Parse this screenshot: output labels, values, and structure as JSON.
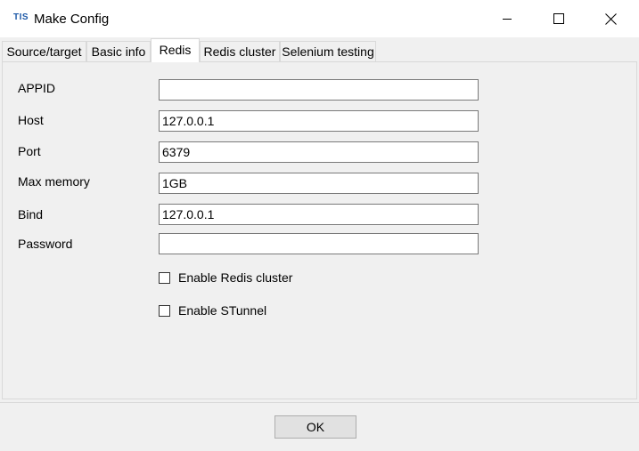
{
  "window": {
    "logo_text": "TIS",
    "title": "Make Config"
  },
  "tabs": [
    {
      "label": "Source/target",
      "active": false
    },
    {
      "label": "Basic info",
      "active": false
    },
    {
      "label": "Redis",
      "active": true
    },
    {
      "label": "Redis cluster",
      "active": false
    },
    {
      "label": "Selenium testing",
      "active": false
    }
  ],
  "form": {
    "appid": {
      "label": "APPID",
      "value": ""
    },
    "host": {
      "label": "Host",
      "value": "127.0.0.1"
    },
    "port": {
      "label": "Port",
      "value": "6379"
    },
    "max_memory": {
      "label": "Max memory",
      "value": "1GB"
    },
    "bind": {
      "label": "Bind",
      "value": "127.0.0.1"
    },
    "password": {
      "label": "Password",
      "value": ""
    },
    "enable_redis_cluster": {
      "label": "Enable Redis cluster",
      "checked": false
    },
    "enable_stunnel": {
      "label": "Enable STunnel",
      "checked": false
    }
  },
  "footer": {
    "ok_label": "OK"
  },
  "colors": {
    "logo": "#1e5aa8",
    "panel_background": "#f0f0f0",
    "titlebar_background": "#ffffff"
  }
}
